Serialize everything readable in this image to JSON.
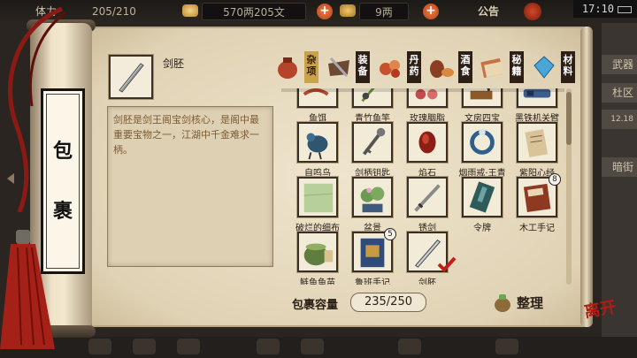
{
  "topbar": {
    "stamina_label": "体力",
    "stamina": "205/210",
    "money": "570两205文",
    "gold": "9两",
    "announcement": "公告",
    "time": "17:10"
  },
  "side_labels": [
    "武器",
    "杜区",
    "12.18",
    "暗街"
  ],
  "backpack_title": [
    "包",
    "裹"
  ],
  "selected": {
    "name": "剑胚",
    "description": "剑胚是剑王阁宝剑核心，是阁中最重要宝物之一，江湖中千金难求一柄。"
  },
  "tabs": [
    {
      "label": "杂项",
      "icon": "jar-icon"
    },
    {
      "label": "装备",
      "icon": "equipment-icon"
    },
    {
      "label": "丹药",
      "icon": "pill-icon"
    },
    {
      "label": "酒食",
      "icon": "wine-food-icon"
    },
    {
      "label": "秘籍",
      "icon": "book-icon"
    },
    {
      "label": "材料",
      "icon": "crystal-icon"
    }
  ],
  "items": [
    {
      "name": "鱼饵",
      "icon": "bait-icon",
      "qty": ""
    },
    {
      "name": "青竹鱼竿",
      "icon": "fishing-rod-icon",
      "qty": ""
    },
    {
      "name": "玫瑰胭脂",
      "icon": "rouge-icon",
      "qty": ""
    },
    {
      "name": "文房四宝",
      "icon": "stationery-icon",
      "qty": ""
    },
    {
      "name": "黑铁机关臂",
      "icon": "iron-arm-icon",
      "qty": ""
    },
    {
      "name": "自鸣鸟",
      "icon": "mechanical-bird-icon",
      "qty": ""
    },
    {
      "name": "剑柄钥匙",
      "icon": "key-icon",
      "qty": ""
    },
    {
      "name": "焰石",
      "icon": "flame-stone-icon",
      "qty": ""
    },
    {
      "name": "烟雨戒·王青",
      "icon": "ring-icon",
      "qty": ""
    },
    {
      "name": "紫阳心经",
      "icon": "scroll-icon",
      "qty": ""
    },
    {
      "name": "破烂的细布",
      "icon": "cloth-icon",
      "qty": ""
    },
    {
      "name": "盆景",
      "icon": "bonsai-icon",
      "qty": ""
    },
    {
      "name": "锈剑",
      "icon": "rusty-sword-icon",
      "qty": ""
    },
    {
      "name": "令牌",
      "icon": "token-icon",
      "qty": ""
    },
    {
      "name": "木工手记",
      "icon": "notebook-icon",
      "qty": "8"
    },
    {
      "name": "鲢鱼鱼苗",
      "icon": "fish-fry-pot-icon",
      "qty": ""
    },
    {
      "name": "鲁班手记",
      "icon": "blue-book-icon",
      "qty": "5"
    },
    {
      "name": "剑胚",
      "icon": "sword-blank-icon",
      "qty": ""
    }
  ],
  "capacity": {
    "label": "包裹容量",
    "value": "235/250"
  },
  "sort_label": "整理",
  "close_label": "离开",
  "colors": {
    "paper": "#e8dcc2",
    "accent_red": "#b21b12",
    "tab_active": "#c9a24a"
  }
}
